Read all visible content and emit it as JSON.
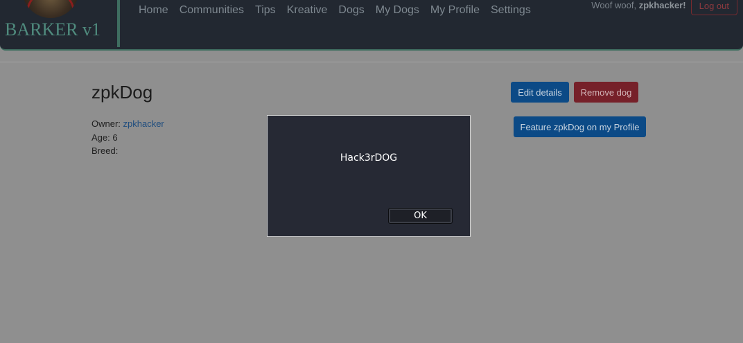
{
  "brand": {
    "name": "BARKER v1"
  },
  "nav": {
    "links": [
      "Home",
      "Communities",
      "Tips",
      "Kreative",
      "Dogs",
      "My Dogs",
      "My Profile",
      "Settings"
    ]
  },
  "user": {
    "greeting": "Woof woof, ",
    "username": "zpkhacker",
    "suffix": "!",
    "logout_label": "Log out"
  },
  "dog": {
    "name": "zpkDog",
    "owner_label": "Owner: ",
    "owner": "zpkhacker",
    "age_label": "Age: ",
    "age": "6",
    "breed_label": "Breed:",
    "breed": ""
  },
  "actions": {
    "edit_label": "Edit details",
    "remove_label": "Remove dog",
    "feature_label": "Feature zpkDog on my Profile"
  },
  "alert": {
    "message": "Hack3rDOG",
    "ok_label": "OK"
  },
  "colors": {
    "overlay_bg": "#8f8f8f",
    "navbar_bg": "#222831",
    "accent_teal": "#3f6e60",
    "primary_btn": "#0c4a86",
    "danger_btn": "#762029",
    "dialog_bg": "#262934"
  }
}
